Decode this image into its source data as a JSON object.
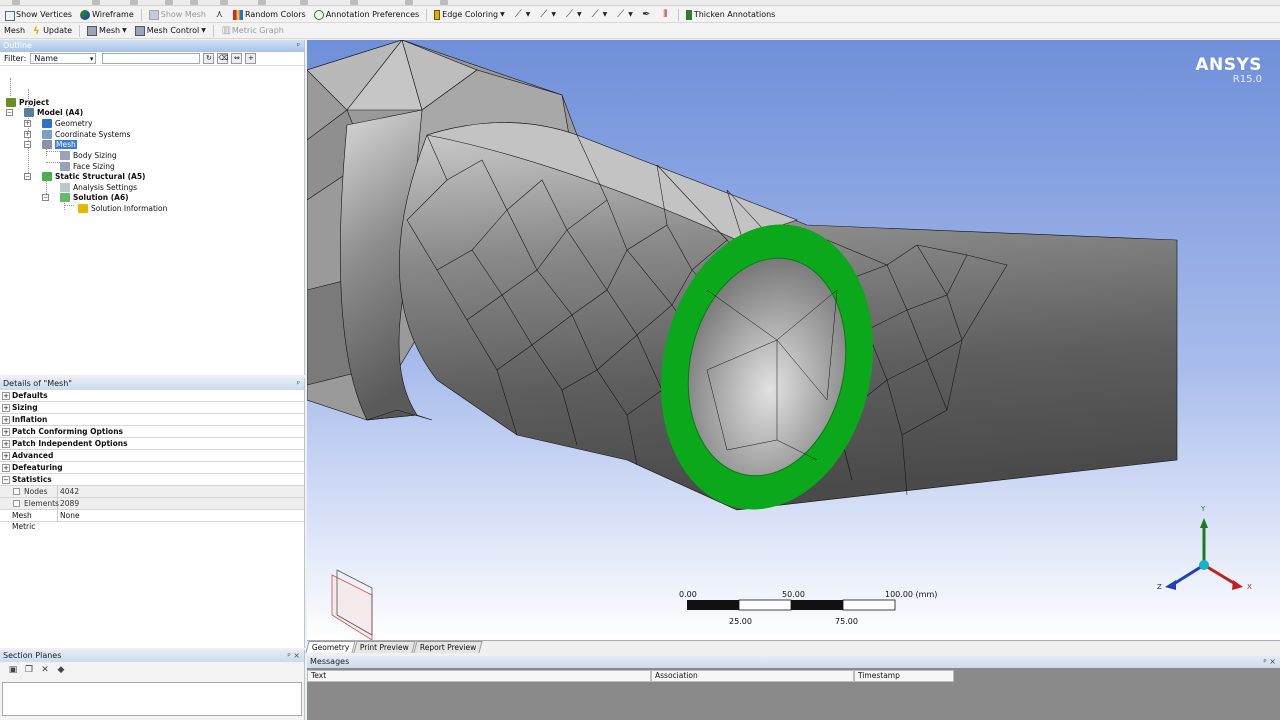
{
  "toolbar1": {
    "show_vertices": "Show Vertices",
    "wireframe": "Wireframe",
    "show_mesh": "Show Mesh",
    "random_colors": "Random Colors",
    "annotation_preferences": "Annotation Preferences",
    "edge_coloring": "Edge Coloring",
    "thicken_annotations": "Thicken Annotations"
  },
  "toolbar2": {
    "mesh": "Mesh",
    "update": "Update",
    "mesh_menu": "Mesh",
    "mesh_control": "Mesh Control",
    "metric_graph": "Metric Graph"
  },
  "outline": {
    "title": "Outline",
    "filter_label": "Filter:",
    "filter_value": "Name",
    "tree": {
      "project": "Project",
      "model": "Model (A4)",
      "geometry": "Geometry",
      "coordinate_systems": "Coordinate Systems",
      "mesh": "Mesh",
      "body_sizing": "Body Sizing",
      "face_sizing": "Face Sizing",
      "static_structural": "Static Structural (A5)",
      "analysis_settings": "Analysis Settings",
      "solution": "Solution (A6)",
      "solution_information": "Solution Information"
    }
  },
  "details": {
    "title": "Details of \"Mesh\"",
    "categories": [
      "Defaults",
      "Sizing",
      "Inflation",
      "Patch Conforming Options",
      "Patch Independent Options",
      "Advanced",
      "Defeaturing",
      "Statistics"
    ],
    "nodes_label": "Nodes",
    "nodes_value": "4042",
    "elements_label": "Elements",
    "elements_value": "2089",
    "mesh_metric_label": "Mesh Metric",
    "mesh_metric_value": "None"
  },
  "section_planes": {
    "title": "Section Planes"
  },
  "viewport": {
    "brand": "ANSYS",
    "version": "R15.0",
    "scale_labels_top": [
      "0.00",
      "50.00",
      "100.00 (mm)"
    ],
    "scale_labels_bottom": [
      "25.00",
      "75.00"
    ],
    "axis_x": "X",
    "axis_y": "Y",
    "axis_z": "Z",
    "highlight_color": "#0aa81a",
    "background_top": "#6f8fd9",
    "background_bottom": "#ffffff"
  },
  "tabs": [
    "Geometry",
    "Print Preview",
    "Report Preview"
  ],
  "messages": {
    "title": "Messages",
    "columns": [
      "Text",
      "Association",
      "Timestamp"
    ]
  }
}
